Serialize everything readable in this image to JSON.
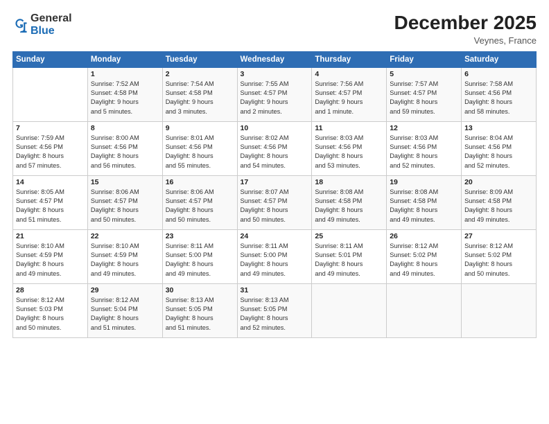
{
  "logo": {
    "general": "General",
    "blue": "Blue"
  },
  "title": "December 2025",
  "location": "Veynes, France",
  "headers": [
    "Sunday",
    "Monday",
    "Tuesday",
    "Wednesday",
    "Thursday",
    "Friday",
    "Saturday"
  ],
  "rows": [
    [
      {
        "day": "",
        "info": ""
      },
      {
        "day": "1",
        "info": "Sunrise: 7:52 AM\nSunset: 4:58 PM\nDaylight: 9 hours\nand 5 minutes."
      },
      {
        "day": "2",
        "info": "Sunrise: 7:54 AM\nSunset: 4:58 PM\nDaylight: 9 hours\nand 3 minutes."
      },
      {
        "day": "3",
        "info": "Sunrise: 7:55 AM\nSunset: 4:57 PM\nDaylight: 9 hours\nand 2 minutes."
      },
      {
        "day": "4",
        "info": "Sunrise: 7:56 AM\nSunset: 4:57 PM\nDaylight: 9 hours\nand 1 minute."
      },
      {
        "day": "5",
        "info": "Sunrise: 7:57 AM\nSunset: 4:57 PM\nDaylight: 8 hours\nand 59 minutes."
      },
      {
        "day": "6",
        "info": "Sunrise: 7:58 AM\nSunset: 4:56 PM\nDaylight: 8 hours\nand 58 minutes."
      }
    ],
    [
      {
        "day": "7",
        "info": "Sunrise: 7:59 AM\nSunset: 4:56 PM\nDaylight: 8 hours\nand 57 minutes."
      },
      {
        "day": "8",
        "info": "Sunrise: 8:00 AM\nSunset: 4:56 PM\nDaylight: 8 hours\nand 56 minutes."
      },
      {
        "day": "9",
        "info": "Sunrise: 8:01 AM\nSunset: 4:56 PM\nDaylight: 8 hours\nand 55 minutes."
      },
      {
        "day": "10",
        "info": "Sunrise: 8:02 AM\nSunset: 4:56 PM\nDaylight: 8 hours\nand 54 minutes."
      },
      {
        "day": "11",
        "info": "Sunrise: 8:03 AM\nSunset: 4:56 PM\nDaylight: 8 hours\nand 53 minutes."
      },
      {
        "day": "12",
        "info": "Sunrise: 8:03 AM\nSunset: 4:56 PM\nDaylight: 8 hours\nand 52 minutes."
      },
      {
        "day": "13",
        "info": "Sunrise: 8:04 AM\nSunset: 4:56 PM\nDaylight: 8 hours\nand 52 minutes."
      }
    ],
    [
      {
        "day": "14",
        "info": "Sunrise: 8:05 AM\nSunset: 4:57 PM\nDaylight: 8 hours\nand 51 minutes."
      },
      {
        "day": "15",
        "info": "Sunrise: 8:06 AM\nSunset: 4:57 PM\nDaylight: 8 hours\nand 50 minutes."
      },
      {
        "day": "16",
        "info": "Sunrise: 8:06 AM\nSunset: 4:57 PM\nDaylight: 8 hours\nand 50 minutes."
      },
      {
        "day": "17",
        "info": "Sunrise: 8:07 AM\nSunset: 4:57 PM\nDaylight: 8 hours\nand 50 minutes."
      },
      {
        "day": "18",
        "info": "Sunrise: 8:08 AM\nSunset: 4:58 PM\nDaylight: 8 hours\nand 49 minutes."
      },
      {
        "day": "19",
        "info": "Sunrise: 8:08 AM\nSunset: 4:58 PM\nDaylight: 8 hours\nand 49 minutes."
      },
      {
        "day": "20",
        "info": "Sunrise: 8:09 AM\nSunset: 4:58 PM\nDaylight: 8 hours\nand 49 minutes."
      }
    ],
    [
      {
        "day": "21",
        "info": "Sunrise: 8:10 AM\nSunset: 4:59 PM\nDaylight: 8 hours\nand 49 minutes."
      },
      {
        "day": "22",
        "info": "Sunrise: 8:10 AM\nSunset: 4:59 PM\nDaylight: 8 hours\nand 49 minutes."
      },
      {
        "day": "23",
        "info": "Sunrise: 8:11 AM\nSunset: 5:00 PM\nDaylight: 8 hours\nand 49 minutes."
      },
      {
        "day": "24",
        "info": "Sunrise: 8:11 AM\nSunset: 5:00 PM\nDaylight: 8 hours\nand 49 minutes."
      },
      {
        "day": "25",
        "info": "Sunrise: 8:11 AM\nSunset: 5:01 PM\nDaylight: 8 hours\nand 49 minutes."
      },
      {
        "day": "26",
        "info": "Sunrise: 8:12 AM\nSunset: 5:02 PM\nDaylight: 8 hours\nand 49 minutes."
      },
      {
        "day": "27",
        "info": "Sunrise: 8:12 AM\nSunset: 5:02 PM\nDaylight: 8 hours\nand 50 minutes."
      }
    ],
    [
      {
        "day": "28",
        "info": "Sunrise: 8:12 AM\nSunset: 5:03 PM\nDaylight: 8 hours\nand 50 minutes."
      },
      {
        "day": "29",
        "info": "Sunrise: 8:12 AM\nSunset: 5:04 PM\nDaylight: 8 hours\nand 51 minutes."
      },
      {
        "day": "30",
        "info": "Sunrise: 8:13 AM\nSunset: 5:05 PM\nDaylight: 8 hours\nand 51 minutes."
      },
      {
        "day": "31",
        "info": "Sunrise: 8:13 AM\nSunset: 5:05 PM\nDaylight: 8 hours\nand 52 minutes."
      },
      {
        "day": "",
        "info": ""
      },
      {
        "day": "",
        "info": ""
      },
      {
        "day": "",
        "info": ""
      }
    ]
  ]
}
